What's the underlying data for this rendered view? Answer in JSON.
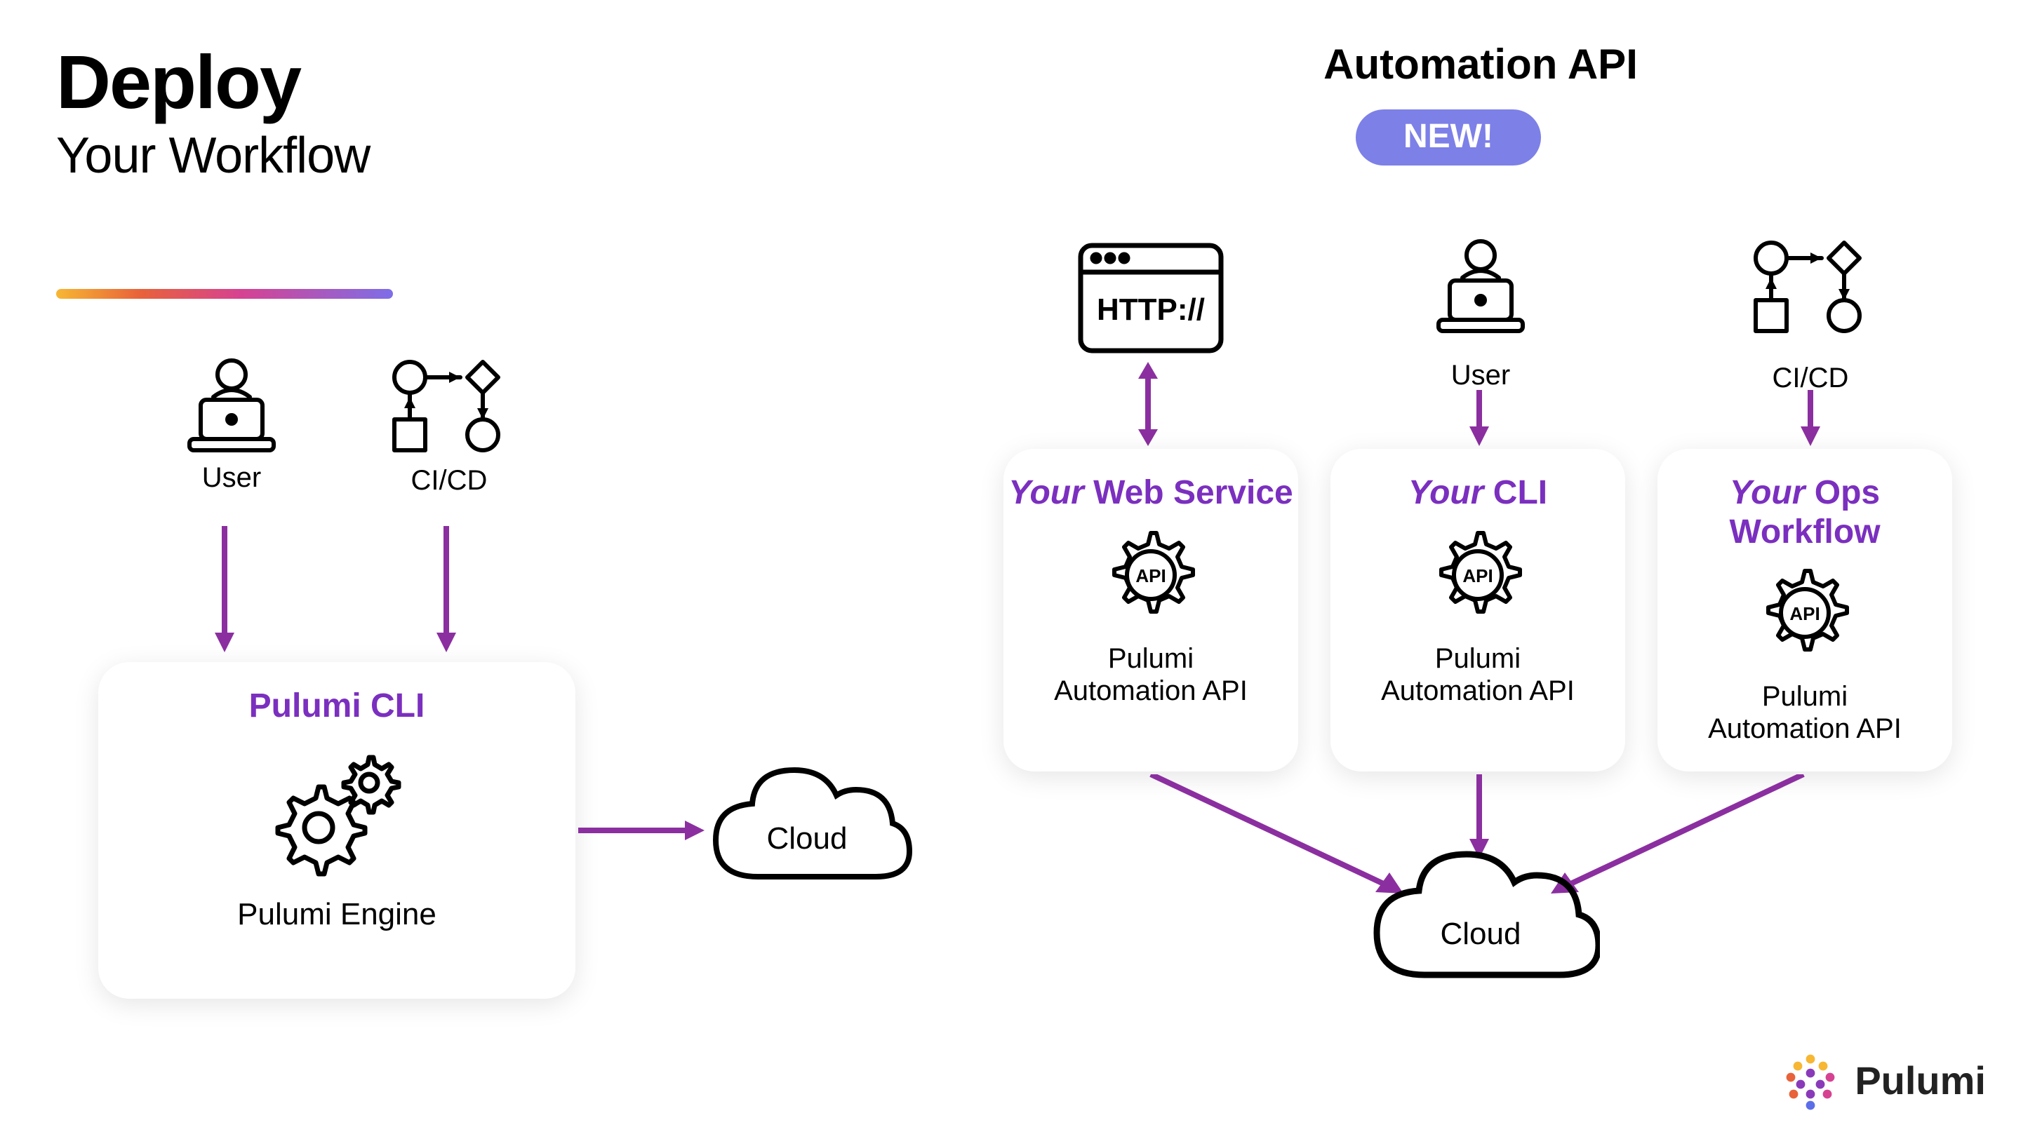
{
  "header": {
    "title": "Deploy",
    "subtitle": "Your Workflow"
  },
  "left": {
    "user_label": "User",
    "cicd_label": "CI/CD",
    "card_title": "Pulumi CLI",
    "card_sub": "Pulumi Engine",
    "cloud_label": "Cloud"
  },
  "right": {
    "section_title": "Automation API",
    "badge": "NEW!",
    "http_label": "HTTP://",
    "user_label": "User",
    "cicd_label": "CI/CD",
    "cards": [
      {
        "your": "Your",
        "rest": " Web Service",
        "sub1": "Pulumi",
        "sub2": "Automation API"
      },
      {
        "your": "Your",
        "rest": " CLI",
        "sub1": "Pulumi",
        "sub2": "Automation API"
      },
      {
        "your": "Your",
        "rest": " Ops Workflow",
        "sub1": "Pulumi",
        "sub2": "Automation API"
      }
    ],
    "cloud_label": "Cloud"
  },
  "footer": {
    "brand": "Pulumi"
  },
  "colors": {
    "accent_purple": "#7b2fbf",
    "arrow_purple": "#8b2fa0",
    "badge_bg": "#7d80e7"
  }
}
